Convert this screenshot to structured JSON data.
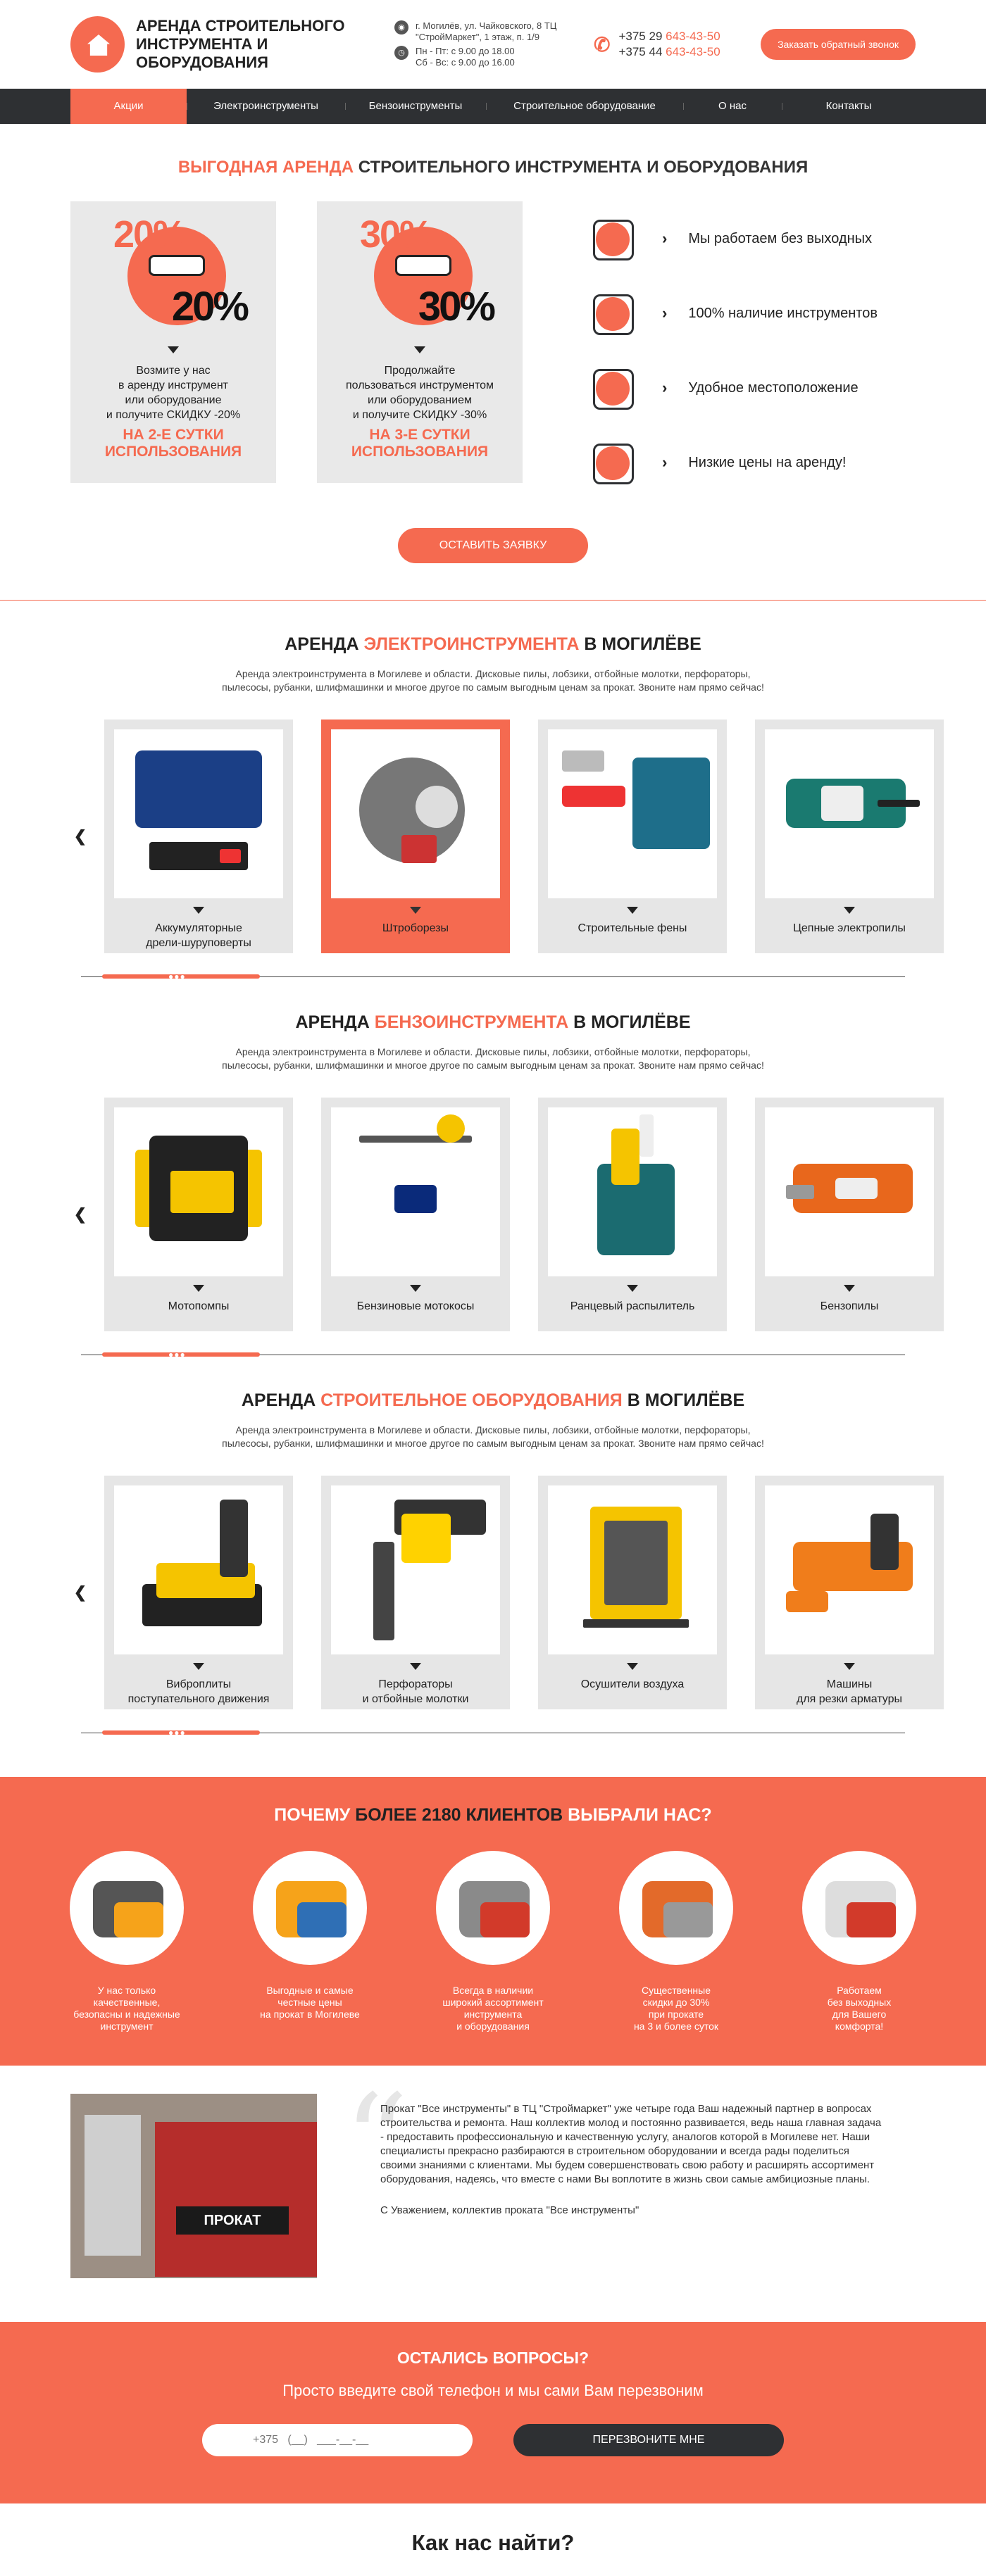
{
  "header": {
    "logo_line1": "Аренда строительного",
    "logo_line2": "инструмента и оборудования",
    "address": "г. Могилёв, ул. Чайковского, 8 ТЦ \"СтройМаркет\", 1 этаж, п. 1/9",
    "hours1": "Пн - Пт: с 9.00 до 18.00",
    "hours2": "Сб - Вс: с 9.00 до 16.00",
    "phone1_prefix": "+375 29",
    "phone1_num": "643-43-50",
    "phone2_prefix": "+375 44",
    "phone2_num": "643-43-50",
    "callback_label": "Заказать обратный звонок"
  },
  "nav": [
    "Акции",
    "Электроинструменты",
    "Бензоинструменты",
    "Строительное оборудование",
    "О нас",
    "Контакты"
  ],
  "promo": {
    "title_accent": "Выгодная аренда",
    "title_rest": "строительного инструмента и оборудования",
    "cards": [
      {
        "ghost": "20%",
        "big": "20%",
        "text1": "Возмите у нас",
        "text2": "в аренду инструмент",
        "text3": "или оборудование",
        "text4": "и получите СКИДКУ -20%",
        "hl1": "на 2-е сутки",
        "hl2": "использования"
      },
      {
        "ghost": "30%",
        "big": "30%",
        "text1": "Продолжайте",
        "text2": "пользоваться инструментом",
        "text3": "или оборудованием",
        "text4": "и получите СКИДКУ -30%",
        "hl1": "на 3-е сутки",
        "hl2": "использования"
      }
    ],
    "benefits": [
      "Мы работаем без выходных",
      "100% наличие инструментов",
      "Удобное местоположение",
      "Низкие цены на аренду!"
    ],
    "order_btn": "Оставить заявку"
  },
  "categories": [
    {
      "title_a": "Аренда",
      "title_accent": "электроинструмента",
      "title_b": "в Могилёве",
      "desc1": "Аренда электроинструмента в Могилеве и области. Дисковые пилы, лобзики, отбойные молотки, перфораторы,",
      "desc2": "пылесосы, рубанки, шлифмашинки и многое другое по самым выгодным ценам за прокат. Звоните нам прямо сейчас!",
      "items": [
        [
          "Аккумуляторные",
          "дрели-шуруповерты"
        ],
        [
          "Штроборезы",
          ""
        ],
        [
          "Строительные фены",
          ""
        ],
        [
          "Цепные электропилы",
          ""
        ]
      ]
    },
    {
      "title_a": "Аренда",
      "title_accent": "бензоинструмента",
      "title_b": "в Могилёве",
      "desc1": "Аренда электроинструмента в Могилеве и области. Дисковые пилы, лобзики, отбойные молотки, перфораторы,",
      "desc2": "пылесосы, рубанки, шлифмашинки и многое другое по самым выгодным ценам за прокат. Звоните нам прямо сейчас!",
      "items": [
        [
          "Мотопомпы",
          ""
        ],
        [
          "Бензиновые мотокосы",
          ""
        ],
        [
          "Ранцевый распылитель",
          ""
        ],
        [
          "Бензопилы",
          ""
        ]
      ]
    },
    {
      "title_a": "Аренда",
      "title_accent": "строительное оборудования",
      "title_b": "в Могилёве",
      "desc1": "Аренда электроинструмента в Могилеве и области. Дисковые пилы, лобзики, отбойные молотки, перфораторы,",
      "desc2": "пылесосы, рубанки, шлифмашинки и многое другое по самым выгодным ценам за прокат. Звоните нам прямо сейчас!",
      "items": [
        [
          "Виброплиты",
          "поступательного движения"
        ],
        [
          "Перфораторы",
          "и отбойные молотки"
        ],
        [
          "Осушители воздуха",
          ""
        ],
        [
          "Машины",
          "для резки арматуры"
        ]
      ]
    }
  ],
  "why": {
    "title_a": "Почему",
    "title_b": "более 2180 клиентов",
    "title_c": "выбрали нас?",
    "items": [
      [
        "У нас только",
        "качественные,",
        "безопасны и надежные",
        "инструмент"
      ],
      [
        "Выгодные и самые",
        "честные цены",
        "на прокат в Могилеве",
        ""
      ],
      [
        "Всегда в наличии",
        "широкий ассортимент",
        "инструмента",
        "и оборудования"
      ],
      [
        "Существенные",
        "скидки до 30%",
        "при прокате",
        "на 3 и более суток"
      ],
      [
        "Работаем",
        "без выходных",
        "для Вашего",
        "комфорта!"
      ]
    ]
  },
  "about": {
    "text": "Прокат \"Все инструменты\" в ТЦ \"Строймаркет\" уже четыре года Ваш надежный партнер в вопросах строительства и ремонта. Наш коллектив молод и постоянно развивается, ведь наша главная задача - предоставить профессиональную и качественную услугу, аналогов которой в Могилеве нет. Наши специалисты прекрасно разбираются в строительном оборудовании и всегда рады поделиться своими знаниями с клиентами. Мы будем совершенствовать свою работу и расширять ассортимент оборудования, надеясь, что вместе с нами Вы воплотите в жизнь свои самые амбициозные планы.",
    "signature": "С Уважением, коллектив проката \"Все инструменты\"",
    "photo_label": "ПРОКАТ"
  },
  "callback": {
    "title": "Остались вопросы?",
    "subtitle": "Просто введите свой телефон и мы сами Вам перезвоним",
    "placeholder": "+375   (__)   ___-__-__",
    "button": "Перезвоните мне"
  },
  "find": "Как нас найти?"
}
